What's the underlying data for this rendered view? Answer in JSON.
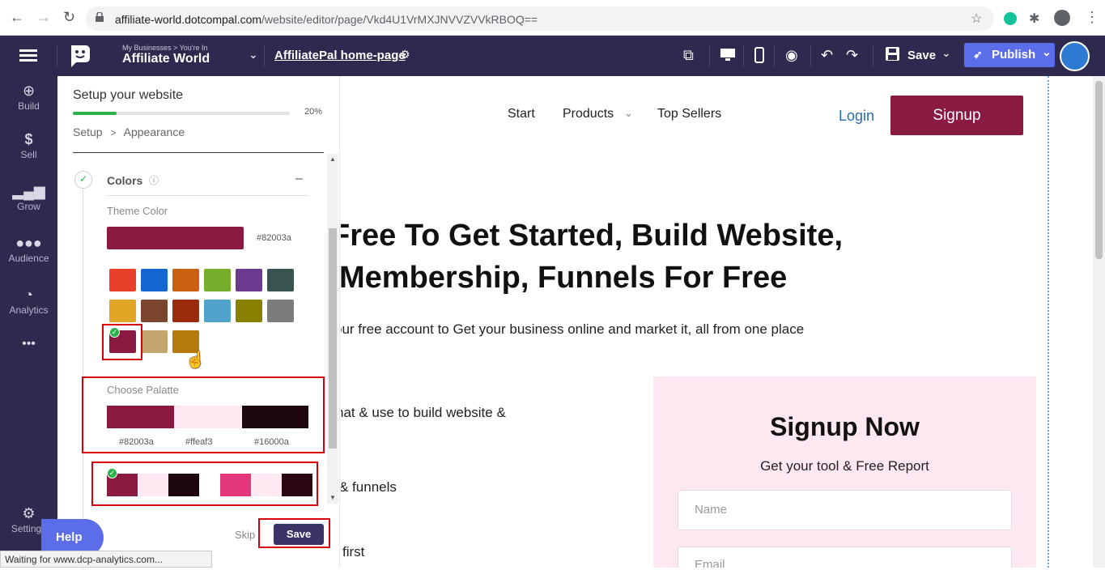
{
  "browser": {
    "url_host": "affiliate-world.dotcompal.com",
    "url_path": "/website/editor/page/Vkd4U1VrMXJNVVZVVkRBOQ=="
  },
  "header": {
    "breadcrumb_small": "My Businesses > You're In",
    "business_name": "Affiliate World",
    "page_name": "AffiliatePal home-page",
    "save_label": "Save",
    "publish_label": "Publish"
  },
  "rail": {
    "items": [
      {
        "label": "Build",
        "icon": "plus-circle-icon"
      },
      {
        "label": "Sell",
        "icon": "dollar-icon"
      },
      {
        "label": "Grow",
        "icon": "bar-chart-icon"
      },
      {
        "label": "Audience",
        "icon": "users-icon"
      },
      {
        "label": "Analytics",
        "icon": "pie-icon"
      }
    ],
    "more": "•••",
    "settings_label": "Settings"
  },
  "setup": {
    "title": "Setup your website",
    "progress_label": "20%",
    "progress": 0.2,
    "crumb_setup": "Setup",
    "crumb_sep": ">",
    "crumb_appearance": "Appearance",
    "section_title": "Colors",
    "section_collapse": "–",
    "theme_color_label": "Theme Color",
    "theme_hex": "#82003a",
    "theme_color": "#8b1a43",
    "swatches": [
      "#e8402a",
      "#1565d0",
      "#c9600f",
      "#76ae2c",
      "#6b3a8f",
      "#385350",
      "#e0a524",
      "#7b4530",
      "#9a2b0c",
      "#51a3cb",
      "#878003",
      "#7c7c7c",
      "#8b1a43",
      "#c3a66e",
      "#b47a0c"
    ],
    "palette_label": "Choose Palatte",
    "palette": [
      {
        "hex": "#82003a",
        "color": "#8b1a43"
      },
      {
        "hex": "#ffeaf3",
        "color": "#ffe8f2"
      },
      {
        "hex": "#16000a",
        "color": "#1e0610"
      }
    ],
    "palette_alt": [
      "#e4367a",
      "#ffe8f2",
      "#2a0610"
    ],
    "skip_label": "Skip",
    "save_label": "Save",
    "help_label": "Help"
  },
  "site": {
    "nav": [
      "Start",
      "Products",
      "Top Sellers"
    ],
    "login": "Login",
    "signup": "Signup",
    "hero_line1": "Free To Get Started, Build Website,",
    "hero_line2": "Membership, Funnels For Free",
    "hero_sub": "our free account to Get your business online and market it, all from one place",
    "bullet1": "hat & use to build website &",
    "bullet2": "& funnels",
    "bullet3": "first",
    "signup_title": "Signup Now",
    "signup_sub": "Get your tool & Free Report",
    "name_placeholder": "Name",
    "email_placeholder": "Email"
  },
  "status": {
    "text": "Waiting for www.dcp-analytics.com..."
  }
}
